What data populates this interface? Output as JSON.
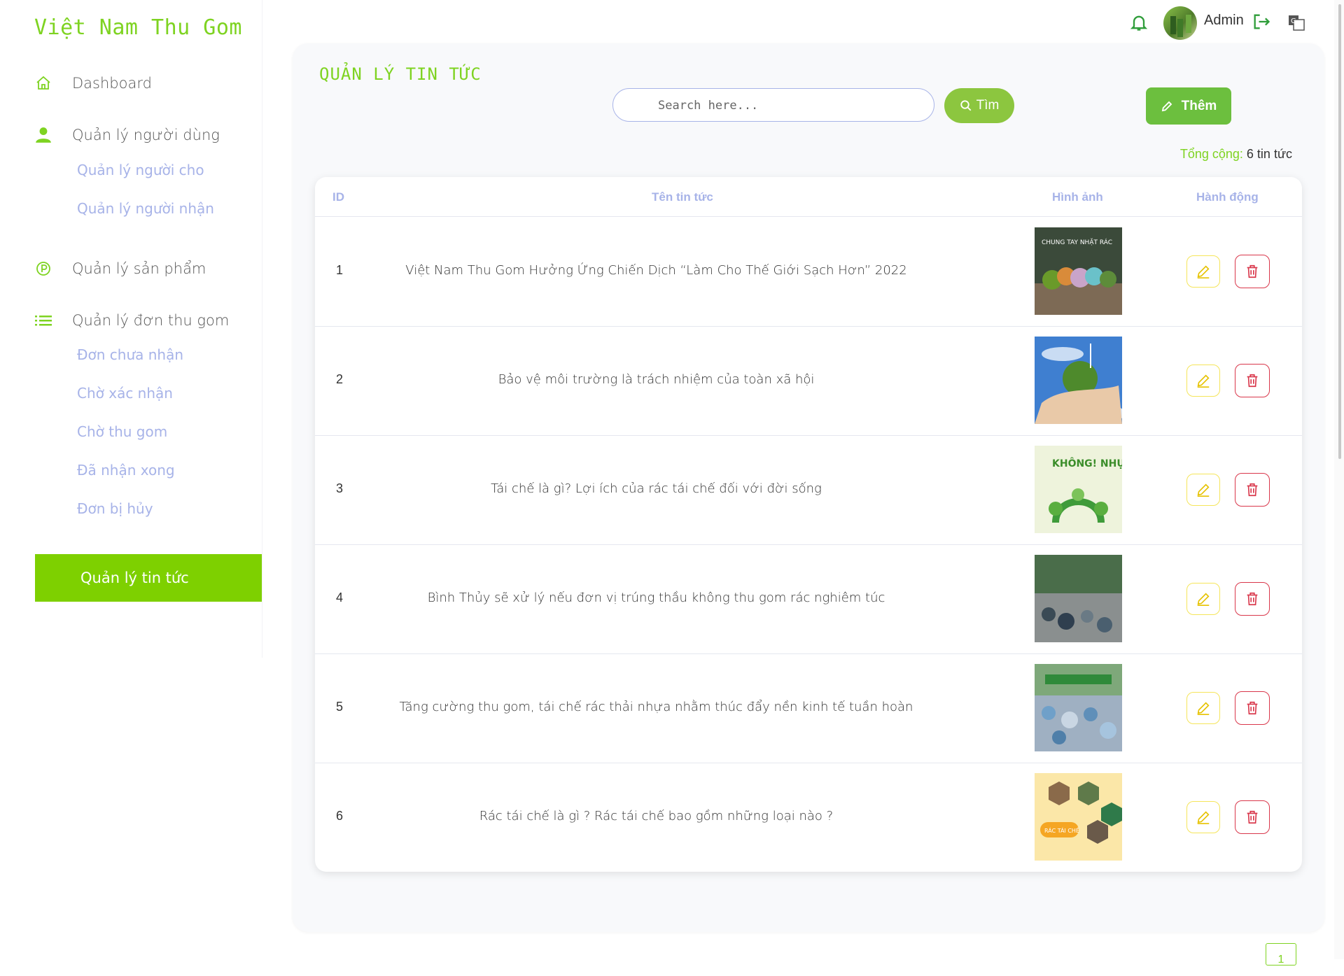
{
  "app": {
    "brand": "Việt Nam Thu Gom"
  },
  "sidebar": {
    "items": [
      {
        "label": "Dashboard",
        "icon": "home-icon"
      },
      {
        "label": "Quản lý người dùng",
        "icon": "user-icon",
        "children": [
          "Quản lý người cho",
          "Quản lý người nhận"
        ]
      },
      {
        "label": "Quản lý sản phẩm",
        "icon": "product-icon"
      },
      {
        "label": "Quản lý đơn thu gom",
        "icon": "list-icon",
        "children": [
          "Đơn chưa nhận",
          "Chờ xác nhận",
          "Chờ thu gom",
          "Đã nhận xong",
          "Đơn bị hủy"
        ]
      }
    ],
    "active": "Quản lý tin tức"
  },
  "topbar": {
    "user": "Admin",
    "icons": [
      "bell-icon",
      "avatar",
      "logout-icon",
      "translate-icon"
    ]
  },
  "page": {
    "title": "QUẢN LÝ TIN TỨC",
    "search_placeholder": "Search here...",
    "search_value": "",
    "find_label": "Tìm",
    "add_label": "Thêm",
    "total_label": "Tổng cộng:",
    "total_value": "6 tin tức"
  },
  "table": {
    "headers": [
      "ID",
      "Tên tin tức",
      "Hình ảnh",
      "Hành động"
    ],
    "rows": [
      {
        "id": "1",
        "name": "Việt Nam Thu Gom Hưởng Ứng Chiến Dịch “Làm Cho Thế Giới Sạch Hơn” 2022",
        "image_text": "CHUNG TAY NHẶT RÁC"
      },
      {
        "id": "2",
        "name": "Bảo vệ môi trường là trách nhiệm của toàn xã hội"
      },
      {
        "id": "3",
        "name": "Tái chế là gì? Lợi ích của rác tái chế đối với đời sống",
        "image_text": "KHÔNG! NHỰA"
      },
      {
        "id": "4",
        "name": "Bình Thủy sẽ xử lý nếu đơn vị trúng thầu không thu gom rác nghiêm túc"
      },
      {
        "id": "5",
        "name": "Tăng cường thu gom, tái chế rác thải nhựa nhằm thúc đẩy nền kinh tế tuần hoàn"
      },
      {
        "id": "6",
        "name": "Rác tái chế là gì ? Rác tái chế bao gồm những loại nào ?",
        "image_text": "RÁC TÁI CHẾ"
      }
    ]
  },
  "pagination": {
    "current": "1"
  },
  "colors": {
    "brand": "#7ed321",
    "active_nav": "#7ed000",
    "sub_nav": "#a7b3e8",
    "edit": "#f5e55a",
    "delete": "#d9374b"
  }
}
